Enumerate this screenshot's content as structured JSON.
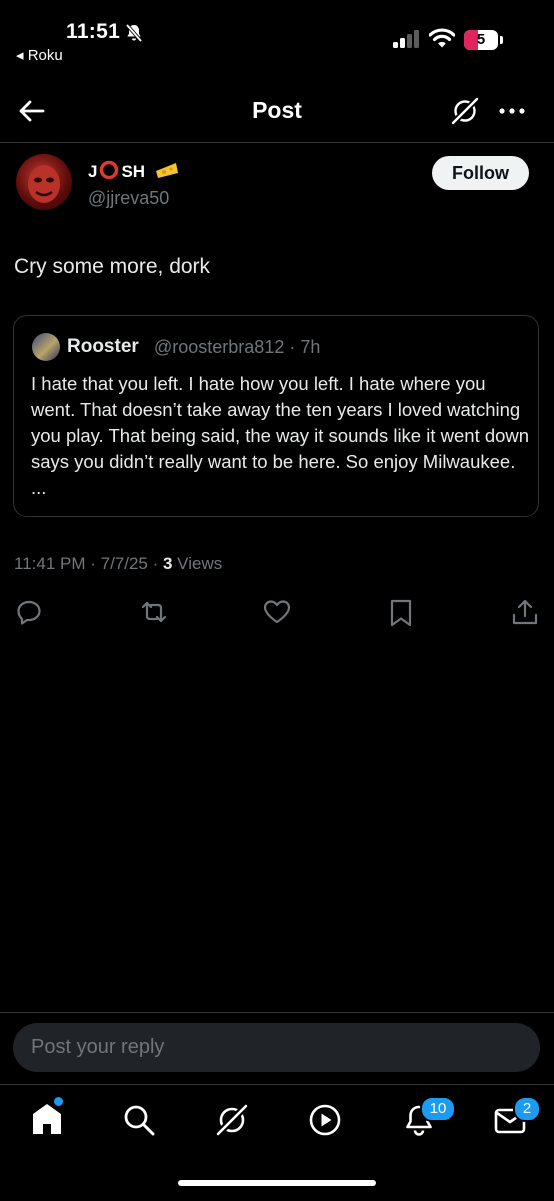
{
  "status_bar": {
    "time": "11:51",
    "back_app": "◂ Roku",
    "battery_level": "5"
  },
  "header": {
    "title": "Post"
  },
  "post": {
    "display_name_start": "J",
    "display_name_end": "SH",
    "handle": "@jjreva50",
    "follow_label": "Follow",
    "text": "Cry some more, dork",
    "timestamp": "11:41 PM · 7/7/25 · ",
    "views_count": "3",
    "views_label": " Views"
  },
  "quote": {
    "name": "Rooster",
    "handle_time": "@roosterbra812 · 7h",
    "text": "I hate that you left. I hate how you left. I hate where you went. That doesn’t take away the ten years I loved watching you play. That being said, the way it sounds like it went down says you didn’t really want to be here. So enjoy Milwaukee. ..."
  },
  "reply": {
    "placeholder": "Post your reply"
  },
  "tabs": {
    "notifications_badge": "10",
    "messages_badge": "2"
  },
  "colors": {
    "accent": "#1d9bf0",
    "battery": "#e0245e"
  },
  "icons": [
    "bell-slash-icon",
    "signal-icon",
    "wifi-icon",
    "back-arrow-icon",
    "grok-icon",
    "more-icon",
    "reply-icon",
    "repost-icon",
    "like-icon",
    "bookmark-icon",
    "share-icon",
    "home-icon",
    "search-icon",
    "video-icon",
    "notifications-icon",
    "messages-icon"
  ]
}
